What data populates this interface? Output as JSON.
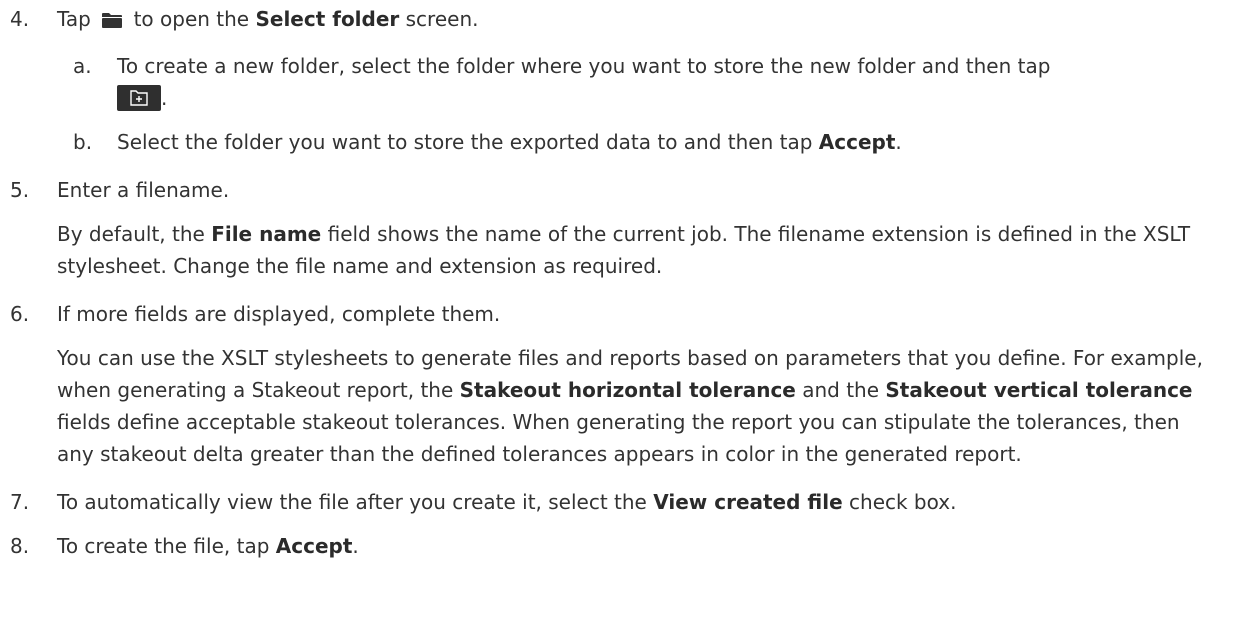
{
  "steps": [
    {
      "num": "4.",
      "pre": "Tap",
      "icon": "folder-icon",
      "mid": "to open the",
      "bold": "Select folder",
      "post": "screen.",
      "substeps": [
        {
          "num": "a.",
          "text": "To create a new folder, select the folder where you want to store the new folder and then tap",
          "icon": "new-folder-icon",
          "post": "."
        },
        {
          "num": "b.",
          "pre": "Select the folder you want to store the exported data to and then tap",
          "bold": "Accept",
          "post": "."
        }
      ]
    },
    {
      "num": "5.",
      "text": "Enter a filename.",
      "para_pre": "By default, the",
      "para_bold": "File name",
      "para_post": "field shows the name of the current job. The filename extension is defined in the XSLT stylesheet. Change the file name and extension as required."
    },
    {
      "num": "6.",
      "text": "If more fields are displayed, complete them.",
      "para_pre": "You can use the XSLT stylesheets to generate files and reports based on parameters that you define. For example, when generating a Stakeout report, the",
      "para_bold1": "Stakeout horizontal tolerance",
      "para_mid": "and the",
      "para_bold2": "Stakeout vertical tolerance",
      "para_post": "fields define acceptable stakeout tolerances. When generating the report you can stipulate the tolerances, then any stakeout delta greater than the defined tolerances appears in color in the generated report."
    },
    {
      "num": "7.",
      "pre": "To automatically view the file after you create it, select the",
      "bold": "View created file",
      "post": "check box."
    },
    {
      "num": "8.",
      "pre": "To create the file, tap",
      "bold": "Accept",
      "post": "."
    }
  ]
}
